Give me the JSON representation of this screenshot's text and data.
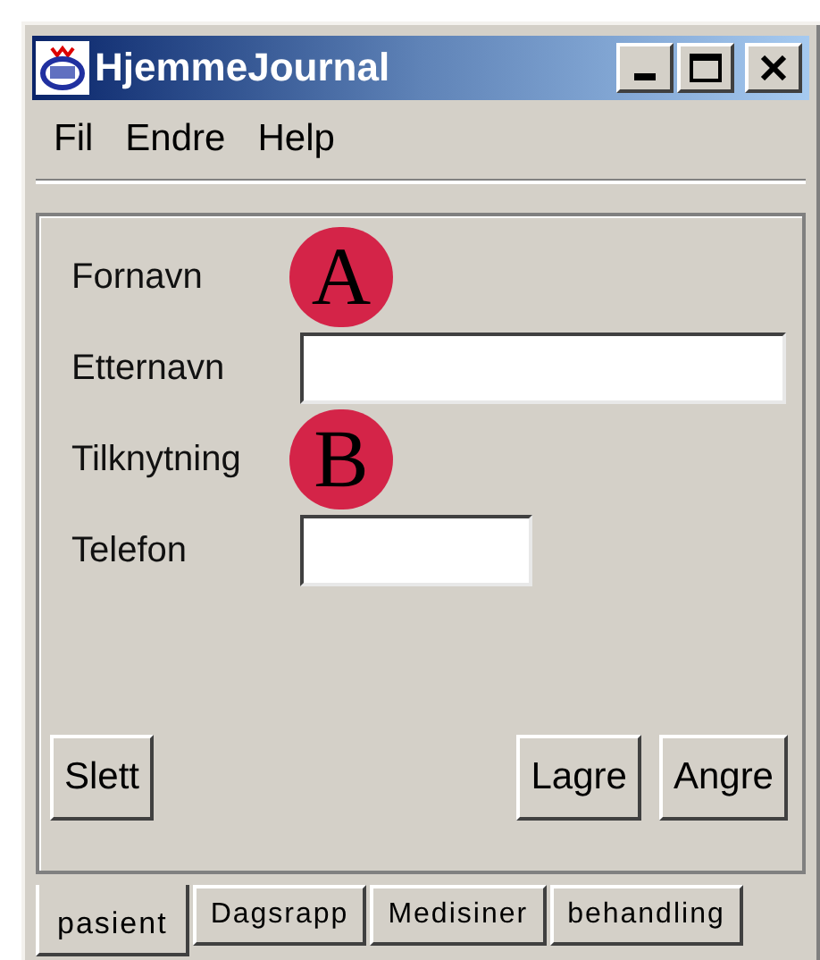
{
  "window": {
    "title": "HjemmeJournal"
  },
  "menu": [
    "Fil",
    "Endre",
    "Help"
  ],
  "form": [
    {
      "label": "Fornavn",
      "kind": "marker",
      "marker": "A"
    },
    {
      "label": "Etternavn",
      "kind": "wide_field"
    },
    {
      "label": "Tilknytning",
      "kind": "marker",
      "marker": "B"
    },
    {
      "label": "Telefon",
      "kind": "narrow_field"
    }
  ],
  "buttons_left": [
    "Slett"
  ],
  "buttons_right": [
    "Lagre",
    "Angre"
  ],
  "tabs": [
    {
      "label": "pasient",
      "selected": true
    },
    {
      "label": "Dagsrapp",
      "selected": false
    },
    {
      "label": "Medisiner",
      "selected": false
    },
    {
      "label": "behandling",
      "selected": false
    }
  ]
}
